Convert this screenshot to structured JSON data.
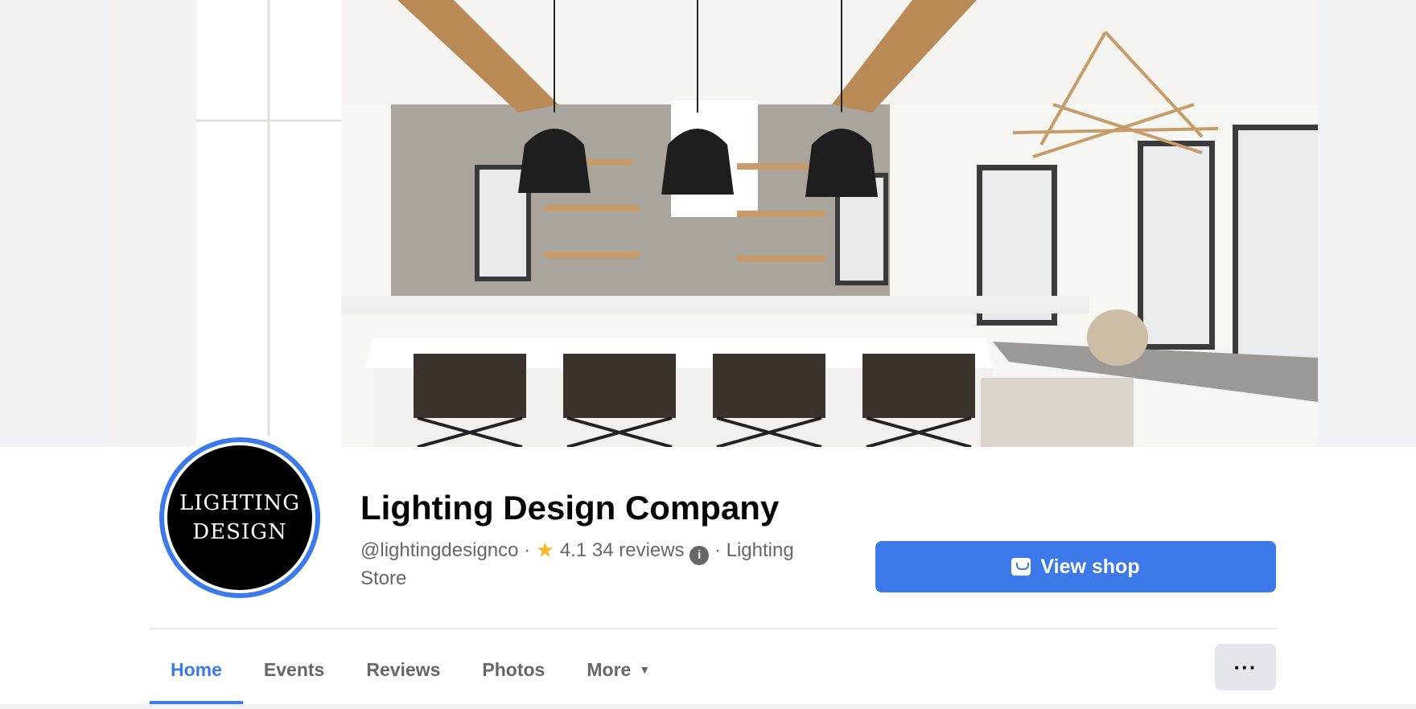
{
  "page": {
    "name": "Lighting Design Company",
    "handle": "@lightingdesignco",
    "separator": "·",
    "rating": "4.1",
    "reviews": "34 reviews",
    "category_prefix": "· Lighting",
    "category_rest": "Store",
    "avatar_line1": "LIGHTING",
    "avatar_line2": "DESIGN",
    "cover_alt": "Kitchen cover photo"
  },
  "actions": {
    "view_shop": "View shop",
    "more_dots": "···"
  },
  "tabs": [
    {
      "label": "Home",
      "active": true
    },
    {
      "label": "Events"
    },
    {
      "label": "Reviews"
    },
    {
      "label": "Photos"
    },
    {
      "label": "More"
    }
  ],
  "icons": {
    "star": "star-icon",
    "info": "info-icon",
    "shop": "shop-icon",
    "caret": "caret-down-icon"
  },
  "colors": {
    "accent": "#3b7ae8",
    "star": "#f7b928",
    "secondary_text": "#65676b"
  }
}
